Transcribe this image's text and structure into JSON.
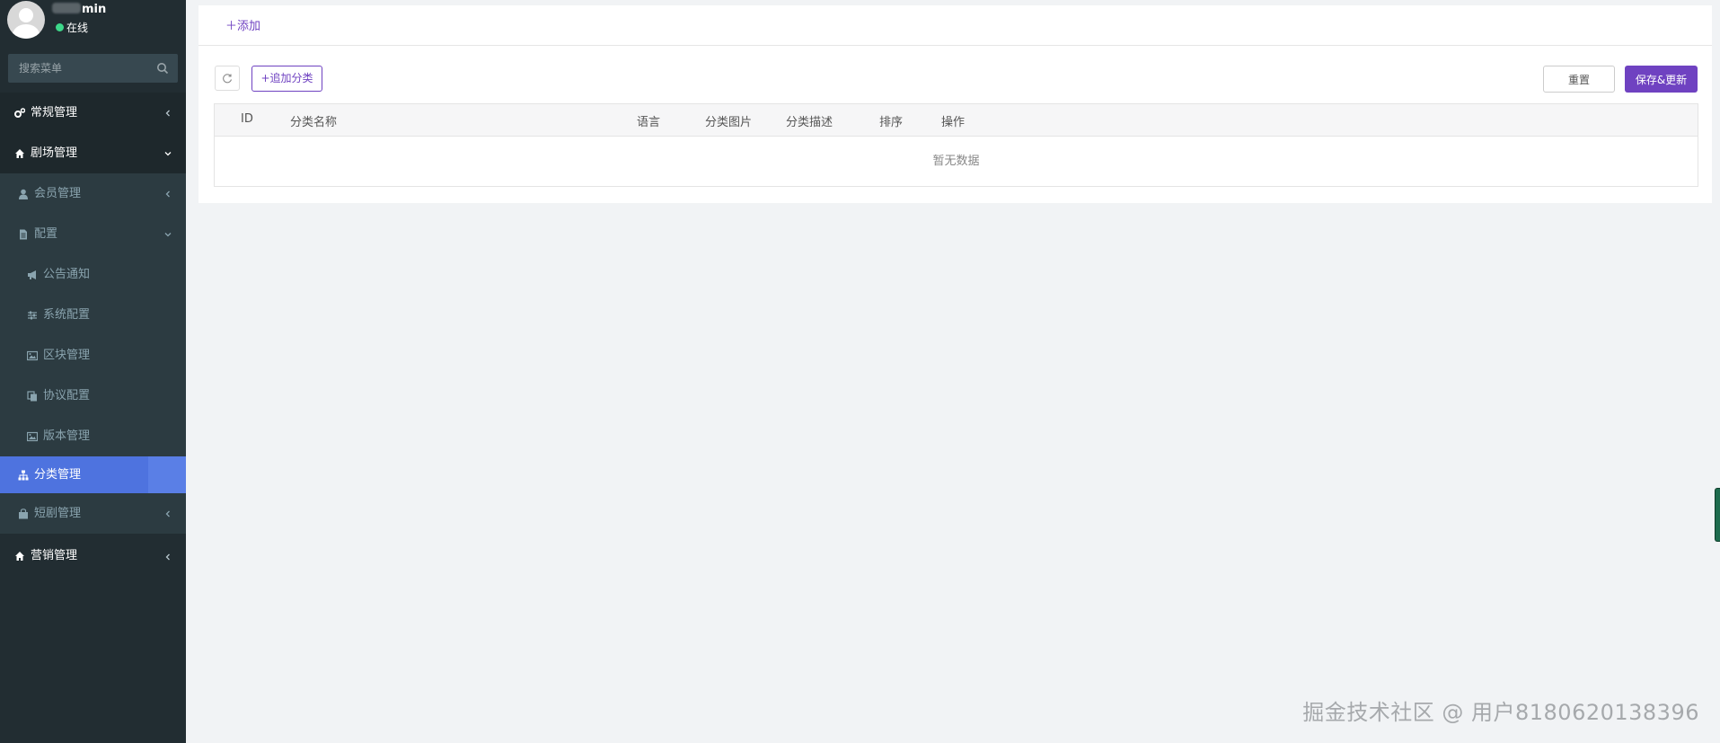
{
  "user": {
    "name_suffix": "min",
    "status": "在线"
  },
  "search": {
    "placeholder": "搜索菜单"
  },
  "menu": {
    "regular": "常规管理",
    "theater": "剧场管理",
    "members": "会员管理",
    "config": "配置",
    "notice": "公告通知",
    "system_config": "系统配置",
    "block": "区块管理",
    "agreement": "协议配置",
    "version": "版本管理",
    "category": "分类管理",
    "short_drama": "短剧管理",
    "marketing": "营销管理"
  },
  "tabbar": {
    "add": "添加"
  },
  "toolbar": {
    "add_category": "追加分类",
    "reset": "重置",
    "save": "保存&更新"
  },
  "table": {
    "columns": [
      "ID",
      "分类名称",
      "语言",
      "分类图片",
      "分类描述",
      "排序",
      "操作"
    ],
    "empty": "暂无数据"
  },
  "watermark": "掘金技术社区 @ 用户8180620138396",
  "colors": {
    "sidebar": "#222d32",
    "accent": "#6f42c1",
    "active_menu": "#4e73df",
    "online": "#3dd88a"
  }
}
